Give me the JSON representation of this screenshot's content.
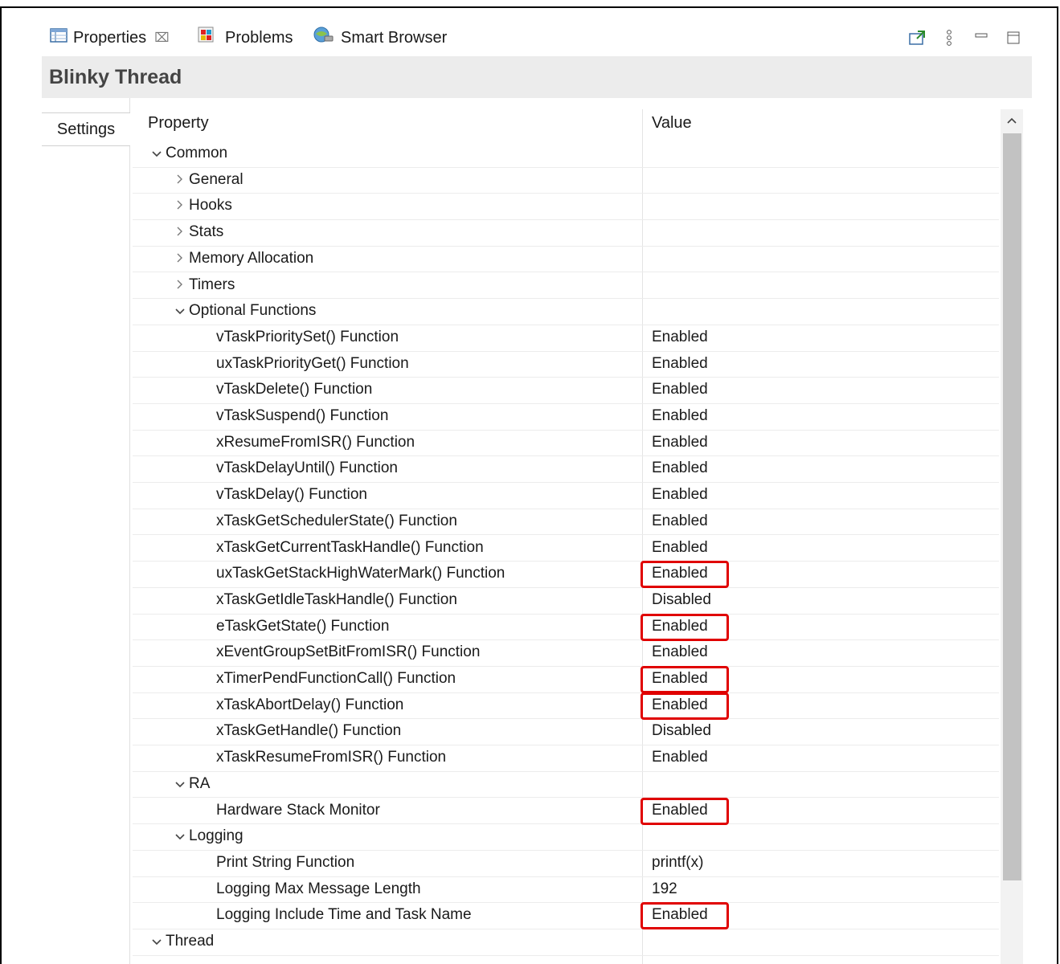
{
  "tabs": [
    {
      "label": "Properties",
      "icon": "properties-table-icon",
      "active": true,
      "close": "⌧"
    },
    {
      "label": "Problems",
      "icon": "problems-icon"
    },
    {
      "label": "Smart Browser",
      "icon": "smart-browser-icon"
    }
  ],
  "view_tools": [
    "pin-icon",
    "view-menu-icon",
    "minimize-icon",
    "maximize-icon"
  ],
  "title": "Blinky Thread",
  "side_tab": "Settings",
  "columns": {
    "property": "Property",
    "value": "Value"
  },
  "rows": [
    {
      "label": "Common",
      "level": 0,
      "state": "expanded",
      "value": ""
    },
    {
      "label": "General",
      "level": 1,
      "state": "collapsed",
      "value": ""
    },
    {
      "label": "Hooks",
      "level": 1,
      "state": "collapsed",
      "value": ""
    },
    {
      "label": "Stats",
      "level": 1,
      "state": "collapsed",
      "value": ""
    },
    {
      "label": "Memory Allocation",
      "level": 1,
      "state": "collapsed",
      "value": ""
    },
    {
      "label": "Timers",
      "level": 1,
      "state": "collapsed",
      "value": ""
    },
    {
      "label": "Optional Functions",
      "level": 1,
      "state": "expanded",
      "value": ""
    },
    {
      "label": "vTaskPrioritySet() Function",
      "level": 2,
      "value": "Enabled"
    },
    {
      "label": "uxTaskPriorityGet() Function",
      "level": 2,
      "value": "Enabled"
    },
    {
      "label": "vTaskDelete() Function",
      "level": 2,
      "value": "Enabled"
    },
    {
      "label": "vTaskSuspend() Function",
      "level": 2,
      "value": "Enabled"
    },
    {
      "label": "xResumeFromISR() Function",
      "level": 2,
      "value": "Enabled"
    },
    {
      "label": "vTaskDelayUntil() Function",
      "level": 2,
      "value": "Enabled"
    },
    {
      "label": "vTaskDelay() Function",
      "level": 2,
      "value": "Enabled"
    },
    {
      "label": "xTaskGetSchedulerState() Function",
      "level": 2,
      "value": "Enabled"
    },
    {
      "label": "xTaskGetCurrentTaskHandle() Function",
      "level": 2,
      "value": "Enabled"
    },
    {
      "label": "uxTaskGetStackHighWaterMark() Function",
      "level": 2,
      "value": "Enabled",
      "highlight": true
    },
    {
      "label": "xTaskGetIdleTaskHandle() Function",
      "level": 2,
      "value": "Disabled"
    },
    {
      "label": "eTaskGetState() Function",
      "level": 2,
      "value": "Enabled",
      "highlight": true
    },
    {
      "label": "xEventGroupSetBitFromISR() Function",
      "level": 2,
      "value": "Enabled"
    },
    {
      "label": "xTimerPendFunctionCall() Function",
      "level": 2,
      "value": "Enabled",
      "highlight": true
    },
    {
      "label": "xTaskAbortDelay() Function",
      "level": 2,
      "value": "Enabled",
      "highlight": true
    },
    {
      "label": "xTaskGetHandle() Function",
      "level": 2,
      "value": "Disabled"
    },
    {
      "label": "xTaskResumeFromISR() Function",
      "level": 2,
      "value": "Enabled"
    },
    {
      "label": "RA",
      "level": 1,
      "state": "expanded",
      "value": ""
    },
    {
      "label": "Hardware Stack Monitor",
      "level": 2,
      "value": "Enabled",
      "highlight": true
    },
    {
      "label": "Logging",
      "level": 1,
      "state": "expanded",
      "value": ""
    },
    {
      "label": "Print String Function",
      "level": 2,
      "value": "printf(x)"
    },
    {
      "label": "Logging Max Message Length",
      "level": 2,
      "value": "192"
    },
    {
      "label": "Logging Include Time and Task Name",
      "level": 2,
      "value": "Enabled",
      "highlight": true
    },
    {
      "label": "Thread",
      "level": 0,
      "state": "expanded",
      "value": ""
    }
  ],
  "colors": {
    "highlight_border": "#e00000",
    "title_bg": "#ececec",
    "scroll_thumb": "#c2c2c2"
  }
}
